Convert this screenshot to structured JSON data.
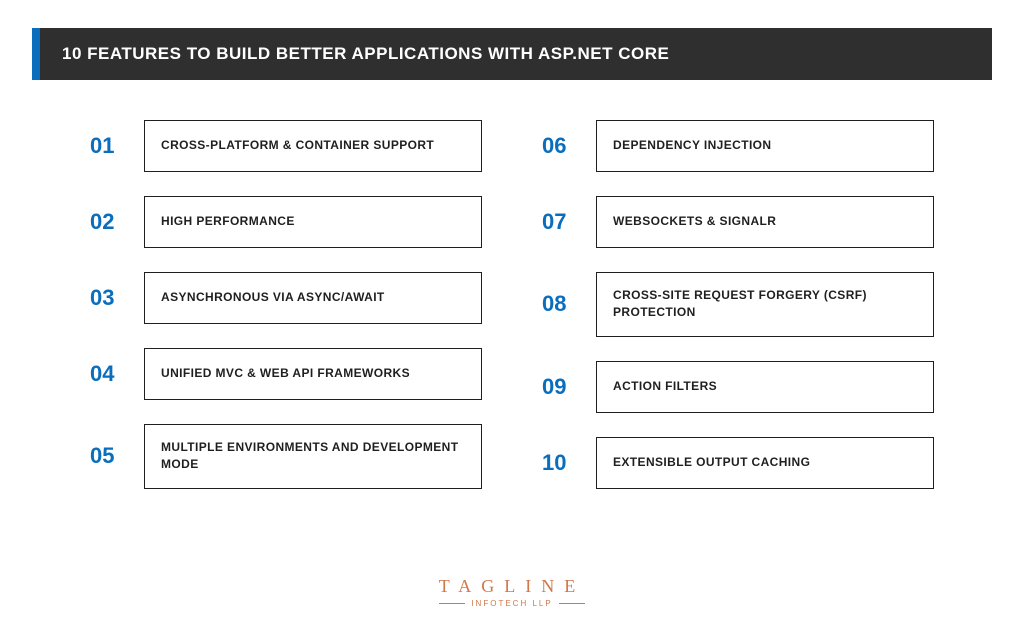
{
  "header": {
    "title": "10 FEATURES TO BUILD BETTER APPLICATIONS WITH ASP.NET CORE"
  },
  "left_column": [
    {
      "num": "01",
      "label": "CROSS-PLATFORM & CONTAINER SUPPORT"
    },
    {
      "num": "02",
      "label": "HIGH PERFORMANCE"
    },
    {
      "num": "03",
      "label": "ASYNCHRONOUS VIA ASYNC/AWAIT"
    },
    {
      "num": "04",
      "label": "UNIFIED MVC & WEB API FRAMEWORKS"
    },
    {
      "num": "05",
      "label": "MULTIPLE ENVIRONMENTS AND DEVELOPMENT MODE"
    }
  ],
  "right_column": [
    {
      "num": "06",
      "label": "DEPENDENCY INJECTION"
    },
    {
      "num": "07",
      "label": "WEBSOCKETS & SIGNALR"
    },
    {
      "num": "08",
      "label": "CROSS-SITE REQUEST FORGERY (CSRF) PROTECTION"
    },
    {
      "num": "09",
      "label": "ACTION FILTERS"
    },
    {
      "num": "10",
      "label": "EXTENSIBLE OUTPUT CACHING"
    }
  ],
  "logo": {
    "main": "TAGLINE",
    "sub": "INFOTECH LLP"
  }
}
